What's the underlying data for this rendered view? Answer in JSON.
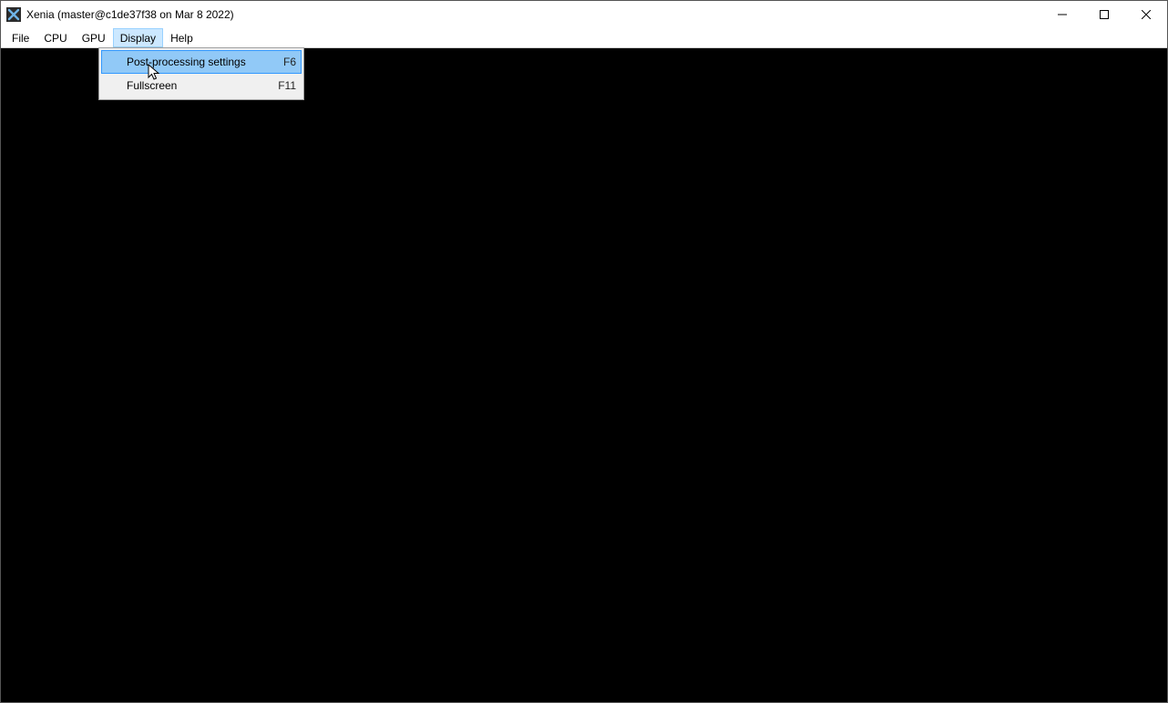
{
  "window": {
    "title": "Xenia (master@c1de37f38 on Mar  8 2022)"
  },
  "menubar": {
    "items": [
      {
        "label": "File"
      },
      {
        "label": "CPU"
      },
      {
        "label": "GPU"
      },
      {
        "label": "Display"
      },
      {
        "label": "Help"
      }
    ]
  },
  "dropdown": {
    "items": [
      {
        "label": "Post-processing settings",
        "shortcut": "F6"
      },
      {
        "label": "Fullscreen",
        "shortcut": "F11"
      }
    ]
  }
}
